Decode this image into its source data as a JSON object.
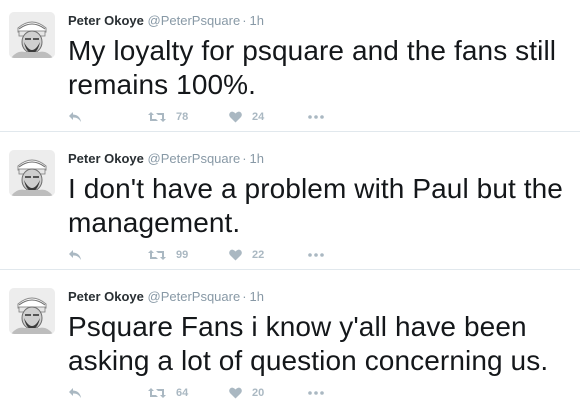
{
  "tweets": [
    {
      "name": "Peter Okoye",
      "handle": "@PeterPsquare",
      "separator": "·",
      "time": "1h",
      "text": "My loyalty for psquare and the fans still remains 100%.",
      "retweets": "78",
      "likes": "24"
    },
    {
      "name": "Peter Okoye",
      "handle": "@PeterPsquare",
      "separator": "·",
      "time": "1h",
      "text": "I don't have a problem with Paul but the management.",
      "retweets": "99",
      "likes": "22"
    },
    {
      "name": "Peter Okoye",
      "handle": "@PeterPsquare",
      "separator": "·",
      "time": "1h",
      "text": "Psquare Fans i know y'all have been asking a lot of question concerning us.",
      "retweets": "64",
      "likes": "20"
    }
  ],
  "icons": {
    "reply": "reply-icon",
    "retweet": "retweet-icon",
    "like": "heart-icon",
    "more": "more-icon"
  },
  "colors": {
    "name": "#292f33",
    "meta": "#8899a6",
    "action": "#aab8c2",
    "divider": "#e1e8ed"
  }
}
